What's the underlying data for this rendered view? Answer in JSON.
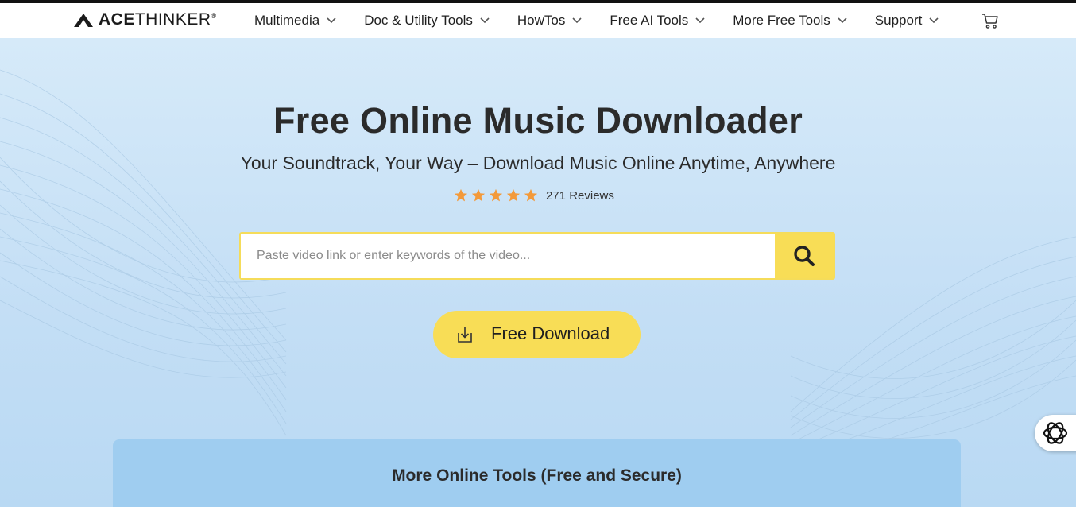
{
  "brand": {
    "logo_bold": "ACE",
    "logo_rest": "THINKER",
    "logo_mark": "®"
  },
  "nav": {
    "items": [
      {
        "label": "Multimedia"
      },
      {
        "label": "Doc & Utility Tools"
      },
      {
        "label": "HowTos"
      },
      {
        "label": "Free AI Tools"
      },
      {
        "label": "More Free Tools"
      },
      {
        "label": "Support"
      }
    ],
    "cart_icon": "cart-icon"
  },
  "hero": {
    "title": "Free Online Music Downloader",
    "subtitle": "Your Soundtrack, Your Way – Download Music Online Anytime, Anywhere",
    "rating_stars": 5,
    "reviews_text": "271 Reviews",
    "search_placeholder": "Paste video link or enter keywords of the video...",
    "download_label": "Free Download"
  },
  "tools": {
    "title": "More Online Tools (Free and Secure)"
  },
  "colors": {
    "accent_yellow": "#f8dd56",
    "star_orange": "#f39a3b",
    "panel_blue": "#9fcdf0"
  }
}
